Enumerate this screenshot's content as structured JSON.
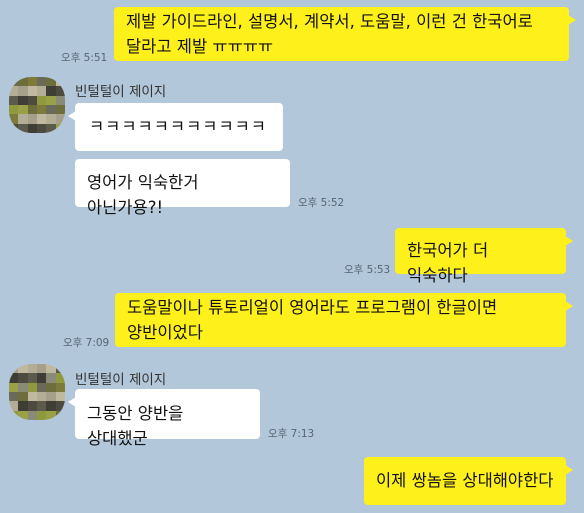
{
  "contact": {
    "name": "빈털털이 제이지"
  },
  "messages": [
    {
      "side": "me",
      "text": "제발 가이드라인, 설명서, 계약서, 도움말, 이런 건 한국어로\n달라고 제발 ㅠㅠㅠㅠ",
      "time": "오후 5:51"
    },
    {
      "side": "them",
      "text": "ㅋㅋㅋㅋㅋㅋㅋㅋㅋㅋㅋ"
    },
    {
      "side": "them",
      "text": "영어가 익숙한거 아닌가용?!",
      "time": "오후 5:52"
    },
    {
      "side": "me",
      "text": "한국어가 더 익숙하다",
      "time": "오후 5:53"
    },
    {
      "side": "me",
      "text": "도움말이나 튜토리얼이 영어라도 프로그램이 한글이면\n양반이었다",
      "time": "오후 7:09"
    },
    {
      "side": "them",
      "text": "그동안 양반을 상대했군",
      "time": "오후 7:13"
    },
    {
      "side": "me",
      "text": "이제 쌍놈을 상대해야한다"
    }
  ],
  "colors": {
    "background": "#b2c7d9",
    "my_bubble": "#fef01b",
    "their_bubble": "#ffffff"
  },
  "avatar_icon": "pixelated-profile-photo"
}
